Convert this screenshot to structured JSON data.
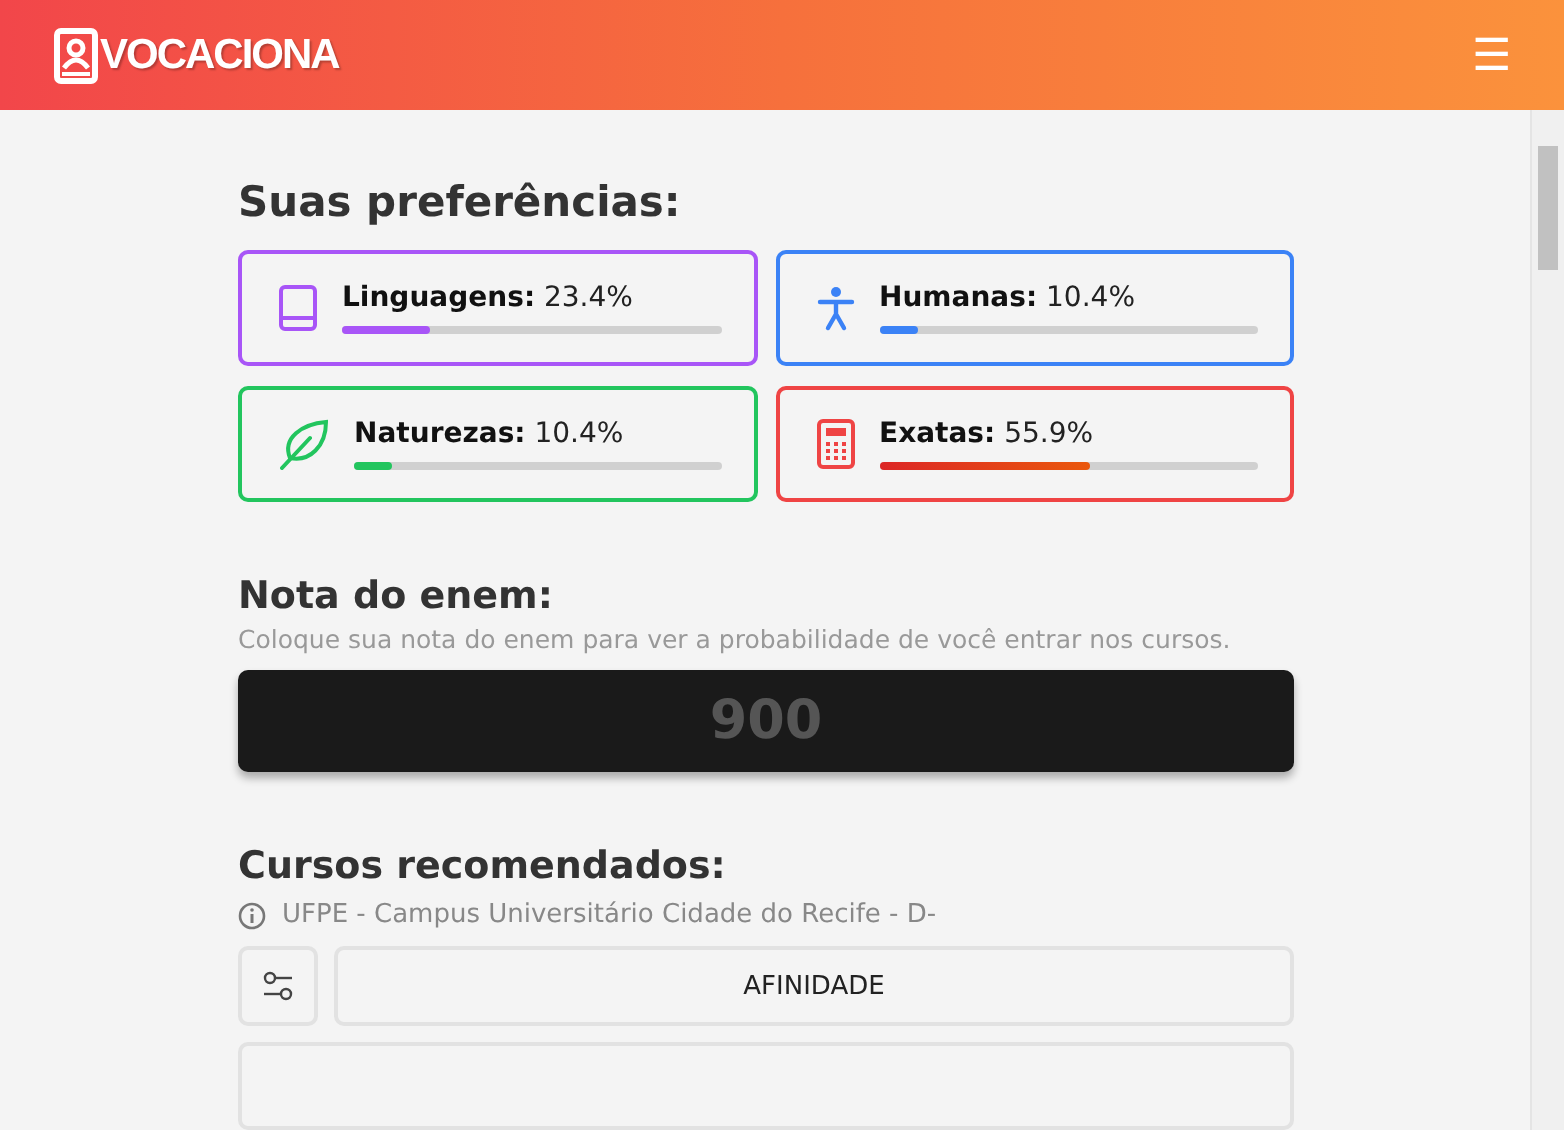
{
  "header": {
    "logo": "VOCACIONA",
    "menu": "☰"
  },
  "preferences": {
    "title": "Suas preferências:",
    "items": [
      {
        "kind": "book",
        "label": "Linguagens:",
        "value": "23.4%",
        "level": 0.234,
        "color": "#a855f7"
      },
      {
        "kind": "person",
        "label": "Humanas:",
        "value": "10.4%",
        "level": 0.104,
        "color": "#3b82f6"
      },
      {
        "kind": "leaf",
        "label": "Naturezas:",
        "value": "10.4%",
        "level": 0.104,
        "color": "#22c55e"
      },
      {
        "kind": "calculator",
        "label": "Exatas:",
        "value": "55.9%",
        "level": 0.559,
        "color": "#ef4444"
      }
    ]
  },
  "enem": {
    "title": "Nota do enem:",
    "hint": "Coloque sua nota do enem para ver a probabilidade de você entrar nos cursos.",
    "placeholder": "900"
  },
  "courses": {
    "title": "Cursos recomendados:",
    "campus": "UFPE - Campus Universitário Cidade do Recife - D-",
    "sort": "AFINIDADE"
  }
}
